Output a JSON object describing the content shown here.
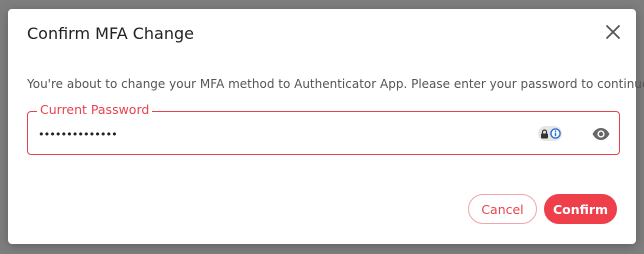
{
  "dialog": {
    "title": "Confirm MFA Change",
    "description": "You're about to change your MFA method to Authenticator App. Please enter your password to continue.",
    "close_icon": "close-icon"
  },
  "password_field": {
    "label": "Current Password",
    "value": "••••••••••••••",
    "type": "password",
    "password_manager_icon": "lock-info-icon",
    "reveal_icon": "eye-icon"
  },
  "actions": {
    "cancel_label": "Cancel",
    "confirm_label": "Confirm"
  },
  "colors": {
    "accent": "#ef3f4b",
    "accent_light": "#f0a5aa",
    "overlay": "#7e7e7e"
  }
}
